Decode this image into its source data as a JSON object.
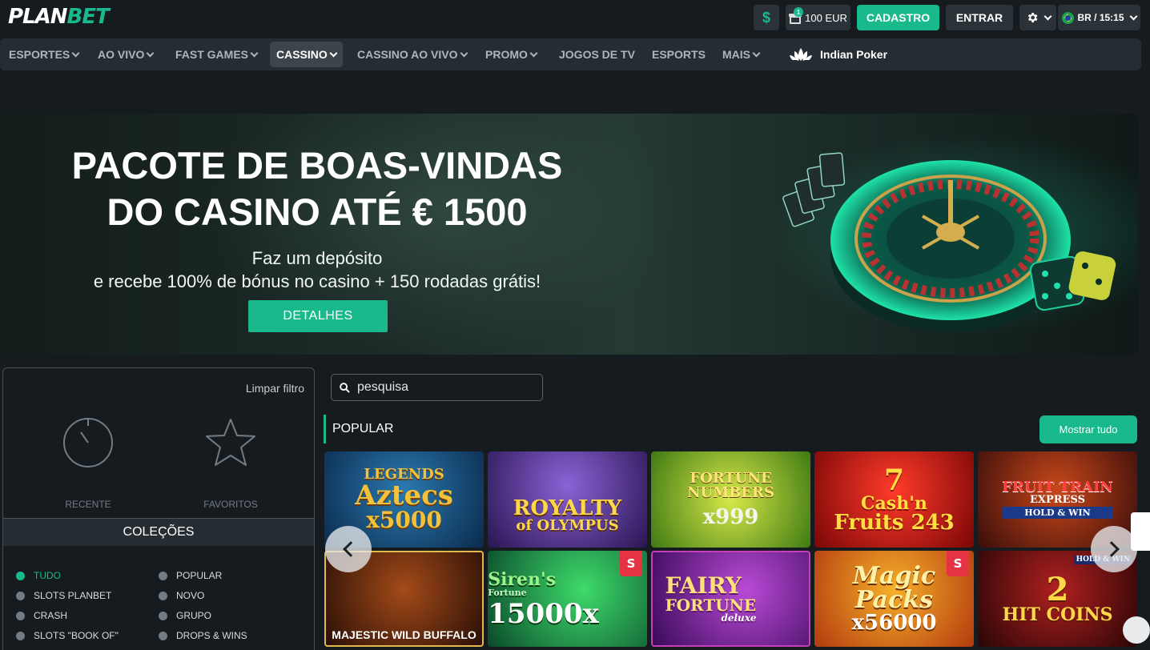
{
  "brand": {
    "logo_part1": "PLAN",
    "logo_part2": "BET",
    "accent": "#19b98b"
  },
  "topbar": {
    "dollar_icon": "dollar-icon",
    "gift_badge": "1",
    "bonus_amount": "100 EUR",
    "signup_label": "CADASTRO",
    "login_label": "ENTRAR",
    "lang_time": "BR / 15:15"
  },
  "nav": {
    "items": [
      {
        "label": "ESPORTES",
        "dropdown": true
      },
      {
        "label": "AO VIVO",
        "dropdown": true
      },
      {
        "label": "FAST GAMES",
        "dropdown": true
      },
      {
        "label": "CASSINO",
        "dropdown": true,
        "active": true
      },
      {
        "label": "CASSINO AO VIVO",
        "dropdown": true
      },
      {
        "label": "PROMO",
        "dropdown": true
      },
      {
        "label": "JOGOS DE TV",
        "dropdown": false
      },
      {
        "label": "ESPORTS",
        "dropdown": false
      },
      {
        "label": "MAIS",
        "dropdown": true
      }
    ],
    "special": "Indian Poker"
  },
  "banner": {
    "title_line1": "PACOTE DE BOAS-VINDAS",
    "title_line2": "DO CASINO ATÉ € 1500",
    "sub_line1": "Faz um depósito",
    "sub_line2": "e recebe 100% de bónus no casino + 150 rodadas grátis!",
    "button": "DETALHES"
  },
  "sidebar": {
    "clear_filter": "Limpar filtro",
    "recent": "RECENTE",
    "favorites": "FAVORITOS",
    "collections_title": "COLEÇÕES",
    "collections": [
      {
        "label": "TUDO",
        "active": true
      },
      {
        "label": "POPULAR"
      },
      {
        "label": "SLOTS PLANBET"
      },
      {
        "label": "NOVO"
      },
      {
        "label": "CRASH"
      },
      {
        "label": "GRUPO"
      },
      {
        "label": "SLOTS \"BOOK OF\""
      },
      {
        "label": "DROPS & WINS"
      }
    ]
  },
  "search": {
    "placeholder": "pesquisa"
  },
  "popular": {
    "title": "POPULAR",
    "show_all": "Mostrar tudo",
    "games": [
      {
        "l1": "LEGENDS",
        "l2": "Aztecs",
        "l3": "x5000"
      },
      {
        "l1": "ROYALTY",
        "l2": "of OLYMPUS",
        "l3": ""
      },
      {
        "l1": "FORTUNE",
        "l2": "NUMBERS",
        "l3": "x999"
      },
      {
        "l1": "7",
        "l2": "Cash'n",
        "l3": "Fruits 243"
      },
      {
        "l1": "FRUIT TRAIN",
        "l2": "EXPRESS",
        "l3": "HOLD & WIN"
      },
      {
        "l1": "MAJESTIC WILD BUFFALO",
        "l2": "",
        "l3": ""
      },
      {
        "l1": "Siren's",
        "l2": "Fortune",
        "l3": "15000x"
      },
      {
        "l1": "FAIRY",
        "l2": "FORTUNE",
        "l3": "deluxe"
      },
      {
        "l1": "Magic",
        "l2": "Packs",
        "l3": "x56000"
      },
      {
        "l1": "2",
        "l2": "HIT COINS",
        "l3": "HOLD & WIN"
      }
    ]
  }
}
